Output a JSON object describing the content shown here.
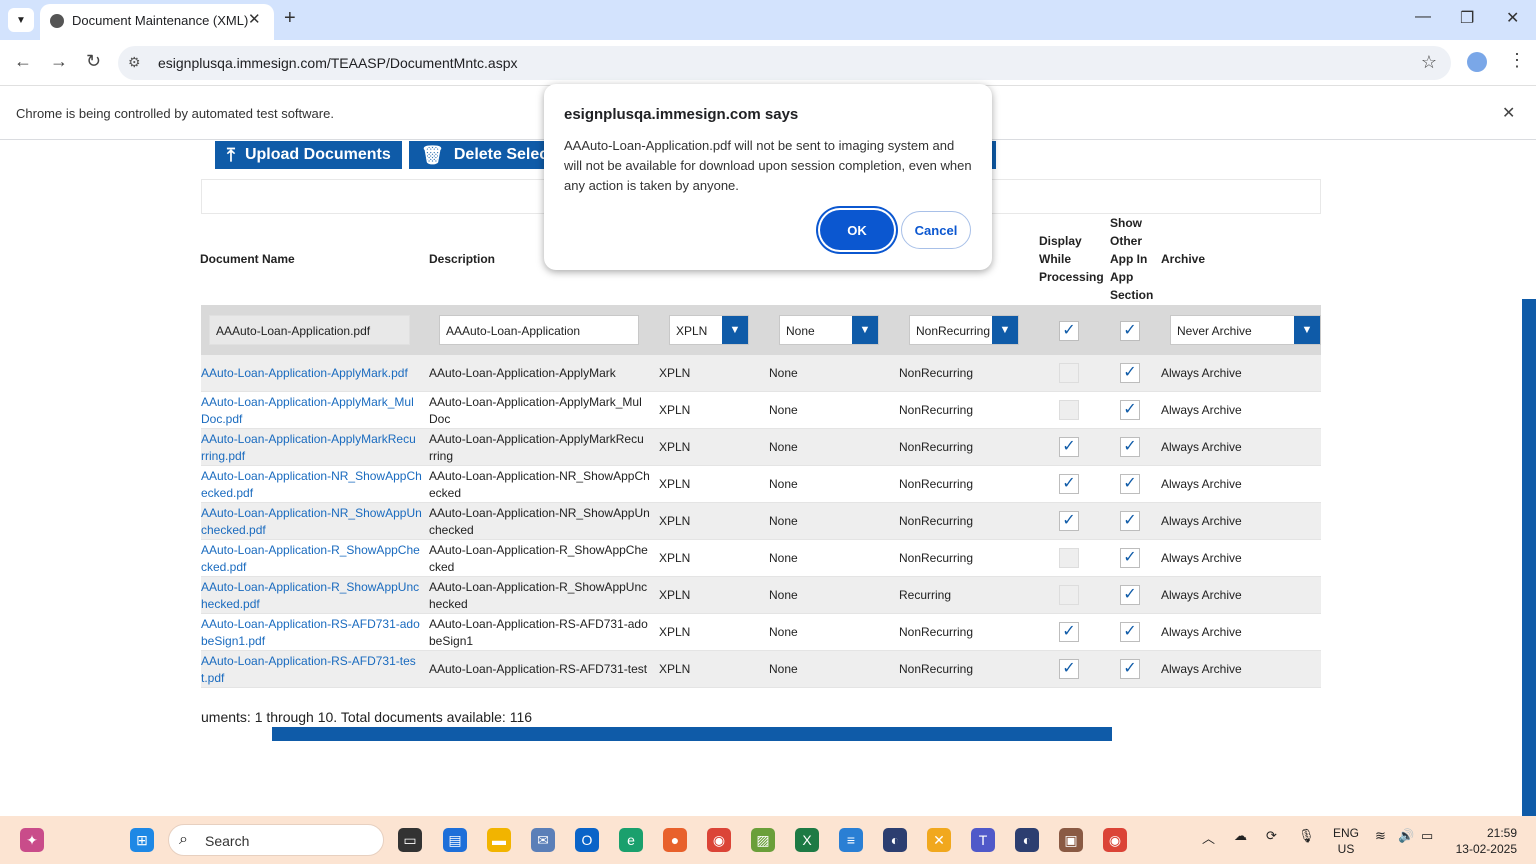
{
  "browser": {
    "tab_title": "Document Maintenance (XML)",
    "url": "esignplusqa.immesign.com/TEAASP/DocumentMntc.aspx",
    "automation_notice": "Chrome is being controlled by automated test software."
  },
  "toolbar": {
    "upload_label": "Upload Documents",
    "delete_label": "Delete Select"
  },
  "table": {
    "headers": {
      "document_name": "Document Name",
      "description": "Description",
      "display_while_processing": [
        "Display",
        "While",
        "Processing"
      ],
      "show_other_app": [
        "Show",
        "Other",
        "App In",
        "App",
        "Section"
      ],
      "archive": "Archive"
    },
    "edit_row": {
      "document_name": "AAAuto-Loan-Application.pdf",
      "description": "AAAuto-Loan-Application",
      "type": "XPLN",
      "option": "None",
      "recurrence": "NonRecurring",
      "display": true,
      "show": true,
      "archive": "Never Archive"
    },
    "rows": [
      {
        "name": [
          "AAuto-Loan-Application-ApplyMark.pdf"
        ],
        "desc": [
          "AAuto-Loan-Application-ApplyMark"
        ],
        "type": "XPLN",
        "option": "None",
        "recurrence": "NonRecurring",
        "display": false,
        "show": true,
        "archive": "Always Archive"
      },
      {
        "name": [
          "AAuto-Loan-Application-ApplyMark_Mul",
          "Doc.pdf"
        ],
        "desc": [
          "AAuto-Loan-Application-ApplyMark_Mul",
          "Doc"
        ],
        "type": "XPLN",
        "option": "None",
        "recurrence": "NonRecurring",
        "display": false,
        "show": true,
        "archive": "Always Archive"
      },
      {
        "name": [
          "AAuto-Loan-Application-ApplyMarkRecu",
          "rring.pdf"
        ],
        "desc": [
          "AAuto-Loan-Application-ApplyMarkRecu",
          "rring"
        ],
        "type": "XPLN",
        "option": "None",
        "recurrence": "NonRecurring",
        "display": true,
        "show": true,
        "archive": "Always Archive"
      },
      {
        "name": [
          "AAuto-Loan-Application-NR_ShowAppCh",
          "ecked.pdf"
        ],
        "desc": [
          "AAuto-Loan-Application-NR_ShowAppCh",
          "ecked"
        ],
        "type": "XPLN",
        "option": "None",
        "recurrence": "NonRecurring",
        "display": true,
        "show": true,
        "archive": "Always Archive"
      },
      {
        "name": [
          "AAuto-Loan-Application-NR_ShowAppUn",
          "checked.pdf"
        ],
        "desc": [
          "AAuto-Loan-Application-NR_ShowAppUn",
          "checked"
        ],
        "type": "XPLN",
        "option": "None",
        "recurrence": "NonRecurring",
        "display": true,
        "show": true,
        "archive": "Always Archive"
      },
      {
        "name": [
          "AAuto-Loan-Application-R_ShowAppChe",
          "cked.pdf"
        ],
        "desc": [
          "AAuto-Loan-Application-R_ShowAppChe",
          "cked"
        ],
        "type": "XPLN",
        "option": "None",
        "recurrence": "NonRecurring",
        "display": false,
        "show": true,
        "archive": "Always Archive"
      },
      {
        "name": [
          "AAuto-Loan-Application-R_ShowAppUnc",
          "hecked.pdf"
        ],
        "desc": [
          "AAuto-Loan-Application-R_ShowAppUnc",
          "hecked"
        ],
        "type": "XPLN",
        "option": "None",
        "recurrence": "Recurring",
        "display": false,
        "show": true,
        "archive": "Always Archive"
      },
      {
        "name": [
          "AAuto-Loan-Application-RS-AFD731-ado",
          "beSign1.pdf"
        ],
        "desc": [
          "AAuto-Loan-Application-RS-AFD731-ado",
          "beSign1"
        ],
        "type": "XPLN",
        "option": "None",
        "recurrence": "NonRecurring",
        "display": true,
        "show": true,
        "archive": "Always Archive"
      },
      {
        "name": [
          "AAuto-Loan-Application-RS-AFD731-tes",
          "t.pdf"
        ],
        "desc": [
          "AAuto-Loan-Application-RS-AFD731-test"
        ],
        "type": "XPLN",
        "option": "None",
        "recurrence": "NonRecurring",
        "display": true,
        "show": true,
        "archive": "Always Archive"
      }
    ]
  },
  "footer_text": "uments: 1 through 10. Total documents available: 116",
  "dialog": {
    "title": "esignplusqa.immesign.com says",
    "message": "AAAuto-Loan-Application.pdf will not be sent to imaging system and will not be available for download upon session completion, even when any action is taken by anyone.",
    "ok_label": "OK",
    "cancel_label": "Cancel"
  },
  "taskbar": {
    "search_placeholder": "Search",
    "lang_top": "ENG",
    "lang_bottom": "US",
    "time": "21:59",
    "date": "13-02-2025"
  },
  "colors": {
    "accent": "#0f5ba8",
    "link": "#1a6bbf",
    "dialog_button": "#0b57d0"
  }
}
